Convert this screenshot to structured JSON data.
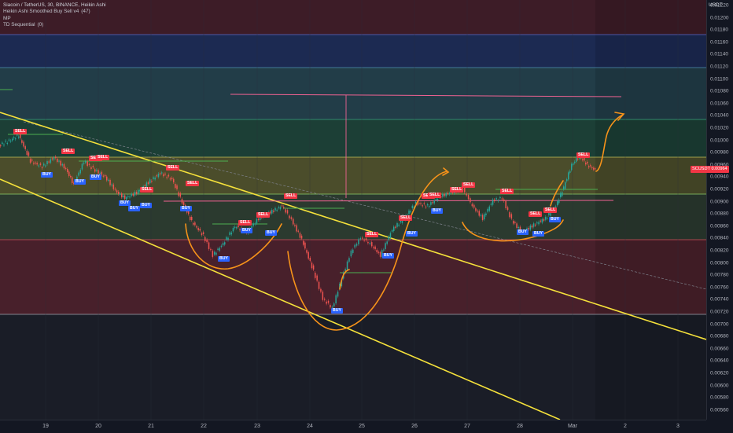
{
  "legend": {
    "title": "Siacoin / TetherUS, 30, BINANCE, Heikin Ashi",
    "indicators": [
      {
        "name": "Heikin Ashi Smoothed Buy Sell v4",
        "params": "(47)"
      },
      {
        "name": "MP",
        "params": ""
      },
      {
        "name": "TD Sequential",
        "params": "(0)"
      }
    ]
  },
  "currency": "USDT",
  "current_price_badge": "SCUSDT   0.00964",
  "price_axis": {
    "ticks": [
      "0.01220",
      "0.01200",
      "0.01180",
      "0.01160",
      "0.01140",
      "0.01120",
      "0.01100",
      "0.01080",
      "0.01060",
      "0.01040",
      "0.01020",
      "0.01000",
      "0.00980",
      "0.00960",
      "0.00940",
      "0.00920",
      "0.00900",
      "0.00880",
      "0.00860",
      "0.00840",
      "0.00820",
      "0.00800",
      "0.00780",
      "0.00760",
      "0.00740",
      "0.00720",
      "0.00700",
      "0.00680",
      "0.00660",
      "0.00640",
      "0.00620",
      "0.00600",
      "0.00580",
      "0.00560"
    ]
  },
  "time_axis": {
    "labels": [
      "19",
      "20",
      "21",
      "22",
      "23",
      "24",
      "25",
      "26",
      "27",
      "28",
      "Mar",
      "2",
      "3"
    ]
  },
  "signals": [
    {
      "type": "sell",
      "label": "SELL"
    },
    {
      "type": "sell",
      "label": "SELL"
    },
    {
      "type": "sell",
      "label": "SELL"
    },
    {
      "type": "sell",
      "label": "SELL"
    },
    {
      "type": "sell",
      "label": "SELL"
    },
    {
      "type": "sell",
      "label": "SELL"
    },
    {
      "type": "sell",
      "label": "SELL"
    },
    {
      "type": "sell",
      "label": "SELL"
    },
    {
      "type": "sell",
      "label": "SELL"
    },
    {
      "type": "sell",
      "label": "SELL"
    },
    {
      "type": "sell",
      "label": "SELL"
    },
    {
      "type": "sell",
      "label": "SELL"
    },
    {
      "type": "sell",
      "label": "SELL"
    },
    {
      "type": "sell",
      "label": "SELL"
    },
    {
      "type": "sell",
      "label": "SELL"
    },
    {
      "type": "sell",
      "label": "SELL"
    },
    {
      "type": "sell",
      "label": "SELL"
    },
    {
      "type": "sell",
      "label": "SELL"
    },
    {
      "type": "sell",
      "label": "SELL"
    },
    {
      "type": "sell",
      "label": "SELL"
    },
    {
      "type": "buy",
      "label": "BUY"
    },
    {
      "type": "buy",
      "label": "BUY"
    },
    {
      "type": "buy",
      "label": "BUY"
    },
    {
      "type": "buy",
      "label": "BUY"
    },
    {
      "type": "buy",
      "label": "BUY"
    },
    {
      "type": "buy",
      "label": "BUY"
    },
    {
      "type": "buy",
      "label": "BUY"
    },
    {
      "type": "buy",
      "label": "BUY"
    },
    {
      "type": "buy",
      "label": "BUY"
    },
    {
      "type": "buy",
      "label": "BUY"
    },
    {
      "type": "buy",
      "label": "BUY"
    },
    {
      "type": "buy",
      "label": "BUY"
    },
    {
      "type": "buy",
      "label": "BUY"
    },
    {
      "type": "buy",
      "label": "BUY"
    },
    {
      "type": "buy",
      "label": "BUY"
    },
    {
      "type": "buy",
      "label": "BUY"
    },
    {
      "type": "buy",
      "label": "BUY"
    }
  ],
  "colors": {
    "background": "#131722",
    "zone_top_red": "#4a2030",
    "zone_blue": "#1d2c55",
    "zone_teal": "#22424a",
    "zone_green": "#1d4a3a",
    "zone_yellow": "#5a5a2a",
    "zone_red": "#4a1e28",
    "candle_up": "#26a69a",
    "candle_down": "#ef5350",
    "trendline": "#f5e13b",
    "drawing": "#f7931a",
    "target": "#f06292",
    "sell": "#f23645",
    "buy": "#2962ff"
  }
}
